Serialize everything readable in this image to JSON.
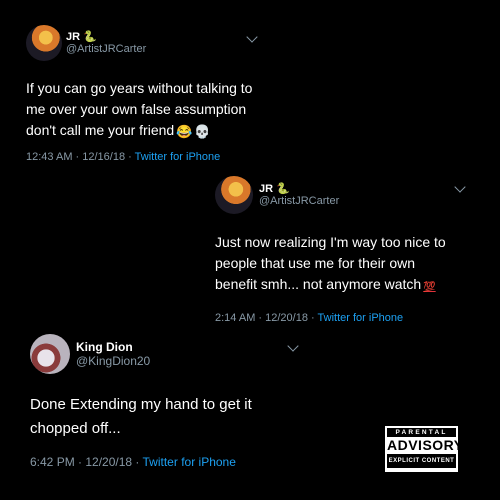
{
  "tweets": [
    {
      "name": "JR",
      "name_emoji": "🐍",
      "handle": "@ArtistJRCarter",
      "lines": [
        "If you can go years without talking to",
        "me over your own false assumption",
        "don't call me your friend"
      ],
      "trailing_emojis": [
        "😂",
        "💀"
      ],
      "time": "12:43 AM · 12/16/18 · ",
      "source": "Twitter for iPhone"
    },
    {
      "name": "JR",
      "name_emoji": "🐍",
      "handle": "@ArtistJRCarter",
      "lines": [
        "Just now realizing I'm way too nice to",
        "people that use me for their own",
        "benefit smh... not anymore watch"
      ],
      "trailing_emojis": [
        "💯"
      ],
      "time": "2:14 AM · 12/20/18 · ",
      "source": "Twitter for iPhone"
    },
    {
      "name": "King Dion",
      "handle": "@KingDion20",
      "lines": [
        "Done Extending my hand to get it",
        "chopped off..."
      ],
      "time": "6:42 PM · 12/20/18 · ",
      "source": "Twitter for iPhone"
    }
  ],
  "advisory": {
    "top": "PARENTAL",
    "middle": "ADVISORY",
    "bottom": "EXPLICIT CONTENT"
  },
  "colors": {
    "background": "#000000",
    "text": "#ffffff",
    "secondary": "#8899a6",
    "link": "#1da1f2"
  }
}
